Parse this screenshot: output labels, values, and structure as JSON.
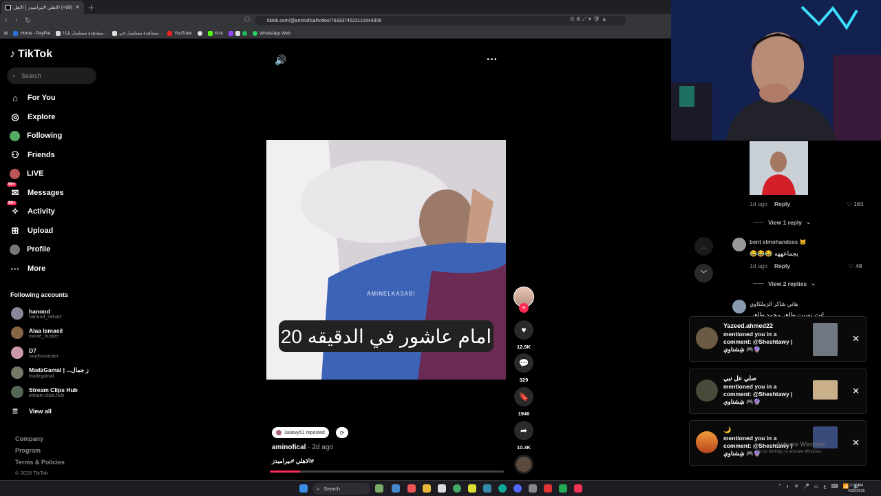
{
  "browser": {
    "tab_title": "(99+) الاهلي #بيراميدز | الاهل...",
    "url": "tiktok.com/@aminofical/video/7633374523110444306",
    "bookmarks": [
      "Home - PayPal",
      "مشاهدة مسلسل بابا ا...",
      "مشاهدة مسلسل جي...",
      "YouTube",
      "Kick",
      "WhatsApp Web"
    ]
  },
  "sidebar": {
    "logo": "TikTok",
    "search_placeholder": "Search",
    "nav": [
      {
        "label": "For You",
        "icon": "home-icon"
      },
      {
        "label": "Explore",
        "icon": "compass-icon"
      },
      {
        "label": "Following",
        "icon": "following-icon"
      },
      {
        "label": "Friends",
        "icon": "friends-icon"
      },
      {
        "label": "LIVE",
        "icon": "live-icon"
      },
      {
        "label": "Messages",
        "icon": "messages-icon",
        "badge": "99+"
      },
      {
        "label": "Activity",
        "icon": "activity-icon",
        "badge": "99+"
      },
      {
        "label": "Upload",
        "icon": "upload-icon"
      },
      {
        "label": "Profile",
        "icon": "profile-icon"
      },
      {
        "label": "More",
        "icon": "more-icon"
      }
    ],
    "following_title": "Following accounts",
    "accounts": [
      {
        "name": "hanood",
        "handle": "hanood_nehad"
      },
      {
        "name": "Alaa Ismaeil",
        "handle": "movie_hustler"
      },
      {
        "name": "D7",
        "handle": "roadtomatster"
      },
      {
        "name": "MadzGamal | ...ز جمال",
        "handle": "madzgamal"
      },
      {
        "name": "Stream Clips Hub",
        "handle": "stream.clips.hub"
      }
    ],
    "view_all": "View all",
    "footer": [
      "Company",
      "Program",
      "Terms & Policies"
    ],
    "copyright": "© 2026 TikTok"
  },
  "video": {
    "caption": "امام عاشور في الدقيقه 20",
    "watermark": "AMINELKASABI",
    "repost_label": "3alawy51 reposted",
    "author": "aminofical",
    "age": "· 2d ago",
    "hashtags": "#الاهلي #بيراميدز",
    "progress": 0.13,
    "likes": "12.9K",
    "comments": "329",
    "saves": "1946",
    "shares": "10.3K"
  },
  "comments": {
    "c1_age": "1d ago",
    "reply": "Reply",
    "c1_likes": "163",
    "c1_view_replies": "View 1 reply",
    "c2_name": "bent elmohandess 🐱",
    "c2_text": "يجماعههه 😂😂😂",
    "c2_age": "1d ago",
    "c2_likes": "48",
    "c2_view_replies": "View 2 replies",
    "c3_name": "هاني شاكر الزملكاوي",
    "c3_text": "انت نسيت طاهر محمد طاهر"
  },
  "notifications": [
    {
      "name": "Yazeed.ahmed22",
      "text": "mentioned you in a comment: @Sheshtawy | شِشتاوي 🎮🔮"
    },
    {
      "name": "صلي عل نبي",
      "text": "mentioned you in a comment: @Sheshtawy | شِشتاوي 🎮🔮"
    },
    {
      "name": "🌙",
      "text": "mentioned you in a comment: @Sheshtawy | شِشتاوي 🎮🔮"
    }
  ],
  "windows": {
    "activate": "Activate Windows",
    "activate_sub": "Go to Settings to activate Windows.",
    "search": "Search",
    "time": "2:04 AM",
    "date": "4/30/2026"
  },
  "colors": {
    "accent": "#fe2c55",
    "background": "#000000"
  }
}
